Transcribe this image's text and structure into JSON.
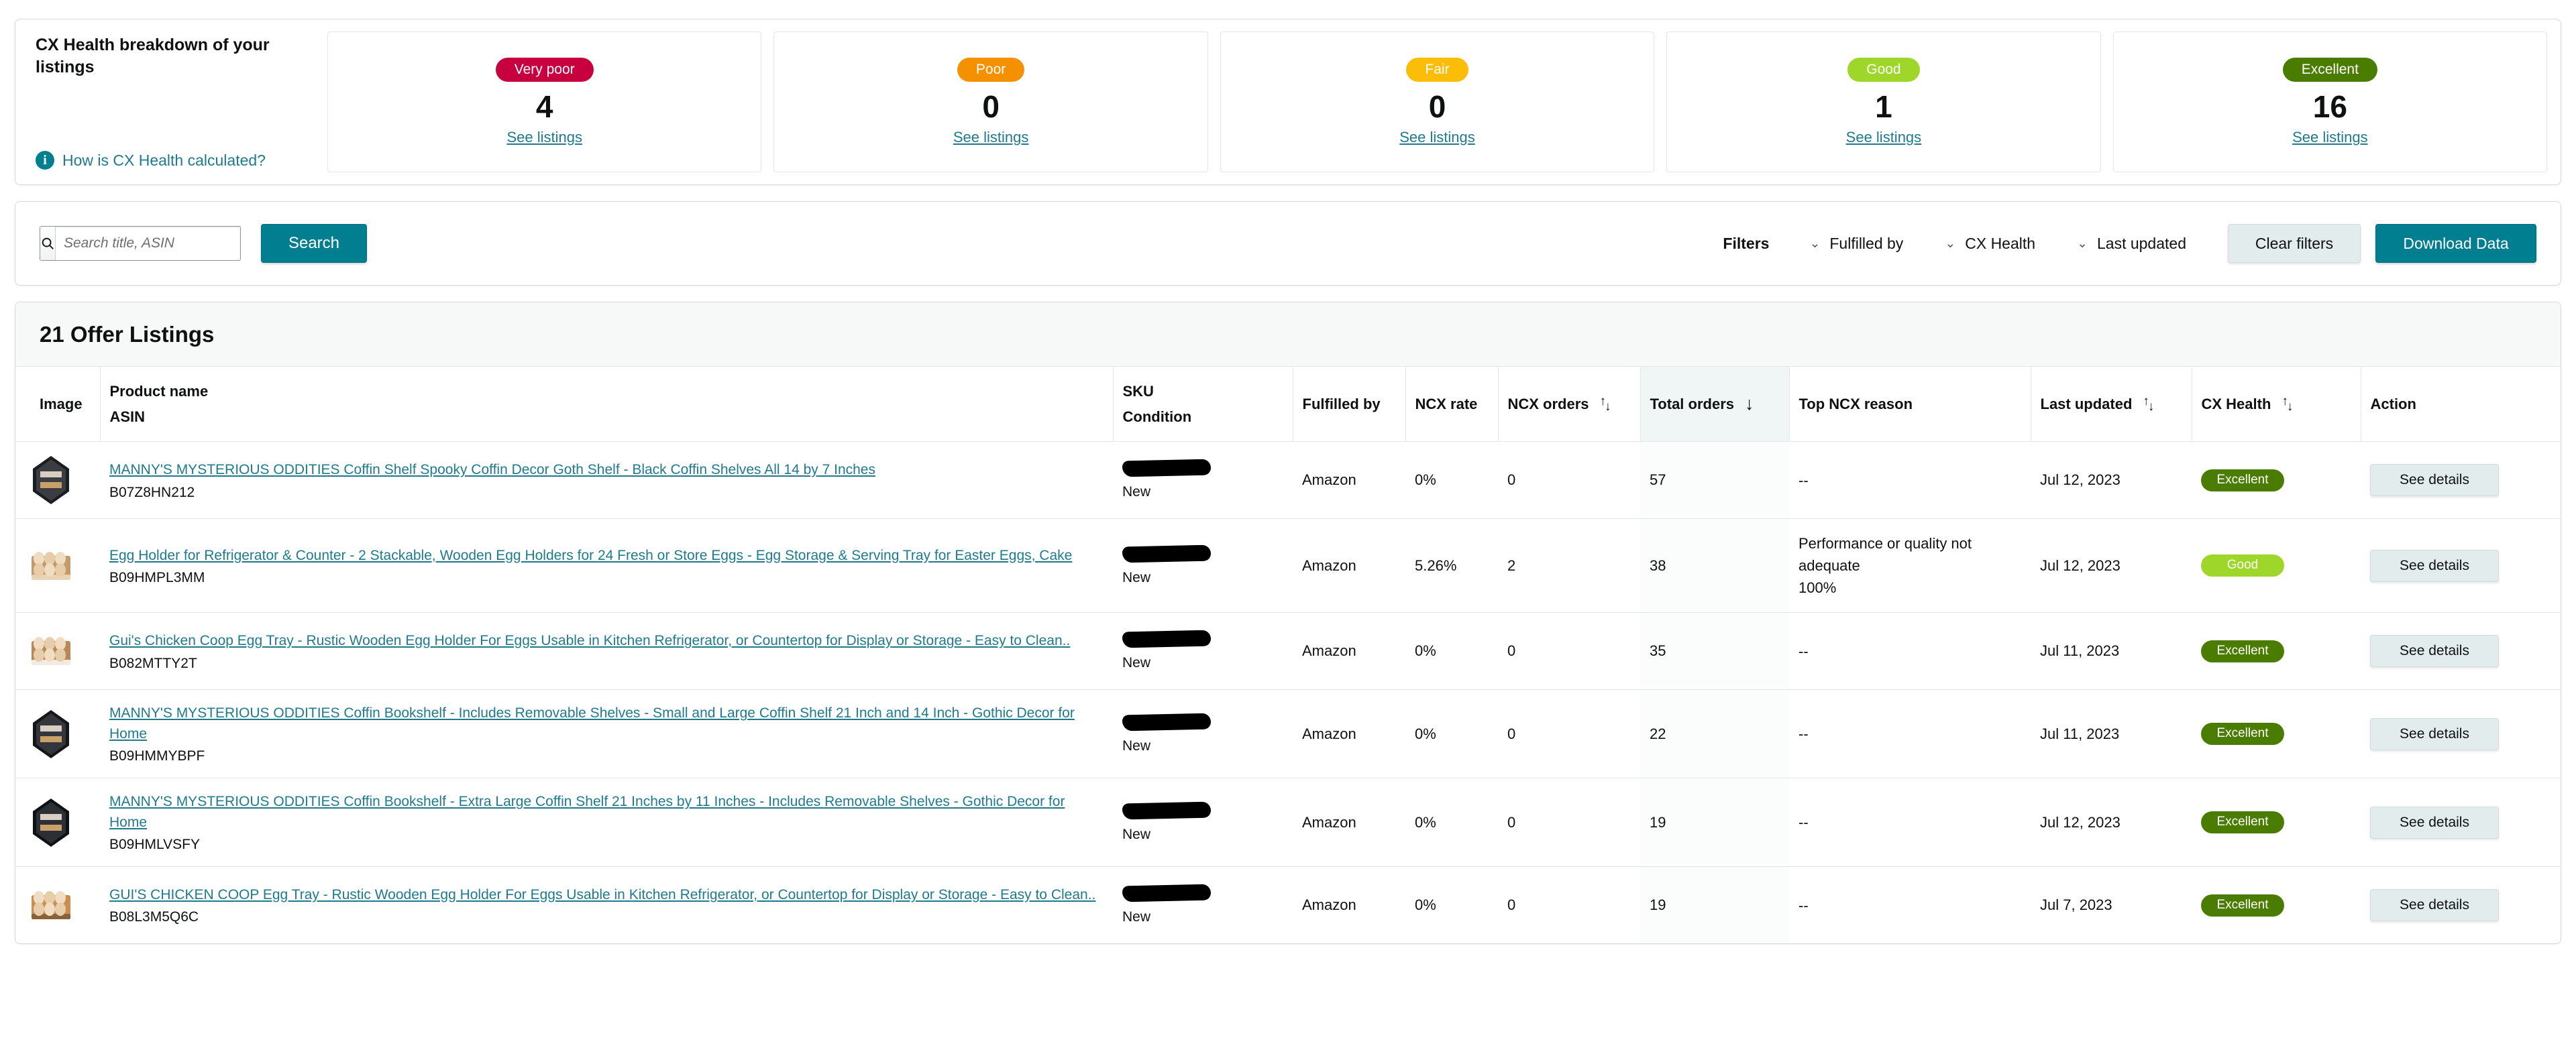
{
  "cx_breakdown": {
    "title": "CX Health breakdown of your listings",
    "help_link": "How is CX Health calculated?",
    "help_icon": "info-icon",
    "cards": [
      {
        "label": "Very poor",
        "count": "4",
        "link": "See listings",
        "color": "#c7003f"
      },
      {
        "label": "Poor",
        "count": "0",
        "link": "See listings",
        "color": "#f59100"
      },
      {
        "label": "Fair",
        "count": "0",
        "link": "See listings",
        "color": "#fbbd08"
      },
      {
        "label": "Good",
        "count": "1",
        "link": "See listings",
        "color": "#9ed62a"
      },
      {
        "label": "Excellent",
        "count": "16",
        "link": "See listings",
        "color": "#4a7c00"
      }
    ]
  },
  "filter_bar": {
    "search_placeholder": "Search title, ASIN",
    "search_value": "",
    "search_icon": "search-icon",
    "search_button": "Search",
    "filters_label": "Filters",
    "dropdowns": [
      {
        "label": "Fulfilled by"
      },
      {
        "label": "CX Health"
      },
      {
        "label": "Last updated"
      }
    ],
    "clear_filters": "Clear filters",
    "download_data": "Download Data"
  },
  "listings": {
    "title": "21 Offer Listings",
    "columns": {
      "image": "Image",
      "product_name": "Product name",
      "asin": "ASIN",
      "sku": "SKU",
      "condition": "Condition",
      "fulfilled_by": "Fulfilled by",
      "ncx_rate": "NCX rate",
      "ncx_orders": "NCX orders",
      "total_orders": "Total orders",
      "top_ncx_reason": "Top NCX reason",
      "last_updated": "Last updated",
      "cx_health": "CX Health",
      "action": "Action"
    },
    "sort": {
      "column": "Total orders",
      "direction": "desc",
      "icon": "arrow-down-icon"
    },
    "action_label": "See details",
    "rows": [
      {
        "product_name": "MANNY'S MYSTERIOUS ODDITIES Coffin Shelf Spooky Coffin Decor Goth Shelf - Black Coffin Shelves All 14 by 7 Inches",
        "asin": "B07Z8HN212",
        "sku": "",
        "condition": "New",
        "fulfilled_by": "Amazon",
        "ncx_rate": "0%",
        "ncx_orders": "0",
        "total_orders": "57",
        "top_ncx_reason": "--",
        "last_updated": "Jul 12, 2023",
        "cx_health": "Excellent",
        "cx_health_color": "#4a7c00",
        "thumb_colors": [
          "#3a3d42",
          "#1c1d20"
        ]
      },
      {
        "product_name": "Egg Holder for Refrigerator & Counter - 2 Stackable, Wooden Egg Holders for 24 Fresh or Store Eggs - Egg Storage & Serving Tray for Easter Eggs, Cake",
        "asin": "B09HMPL3MM",
        "sku": "",
        "condition": "New",
        "fulfilled_by": "Amazon",
        "ncx_rate": "5.26%",
        "ncx_orders": "2",
        "total_orders": "38",
        "top_ncx_reason": "Performance or quality not adequate\n100%",
        "last_updated": "Jul 12, 2023",
        "cx_health": "Good",
        "cx_health_color": "#9ed62a",
        "thumb_colors": [
          "#c49a68",
          "#e8d3b4"
        ]
      },
      {
        "product_name": "Gui's Chicken Coop Egg Tray - Rustic Wooden Egg Holder For Eggs Usable in Kitchen Refrigerator, or Countertop for Display or Storage - Easy to Clean..",
        "asin": "B082MTTY2T",
        "sku": "",
        "condition": "New",
        "fulfilled_by": "Amazon",
        "ncx_rate": "0%",
        "ncx_orders": "0",
        "total_orders": "35",
        "top_ncx_reason": "--",
        "last_updated": "Jul 11, 2023",
        "cx_health": "Excellent",
        "cx_health_color": "#4a7c00",
        "thumb_colors": [
          "#b78a58",
          "#f0ece3"
        ]
      },
      {
        "product_name": "MANNY'S MYSTERIOUS ODDITIES Coffin Bookshelf - Includes Removable Shelves - Small and Large Coffin Shelf 21 Inch and 14 Inch - Gothic Decor for Home",
        "asin": "B09HMMYBPF",
        "sku": "",
        "condition": "New",
        "fulfilled_by": "Amazon",
        "ncx_rate": "0%",
        "ncx_orders": "0",
        "total_orders": "22",
        "top_ncx_reason": "--",
        "last_updated": "Jul 11, 2023",
        "cx_health": "Excellent",
        "cx_health_color": "#4a7c00",
        "thumb_colors": [
          "#33363b",
          "#15161a"
        ]
      },
      {
        "product_name": "MANNY'S MYSTERIOUS ODDITIES Coffin Bookshelf - Extra Large Coffin Shelf 21 Inches by 11 Inches - Includes Removable Shelves - Gothic Decor for Home",
        "asin": "B09HMLVSFY",
        "sku": "",
        "condition": "New",
        "fulfilled_by": "Amazon",
        "ncx_rate": "0%",
        "ncx_orders": "0",
        "total_orders": "19",
        "top_ncx_reason": "--",
        "last_updated": "Jul 12, 2023",
        "cx_health": "Excellent",
        "cx_health_color": "#4a7c00",
        "thumb_colors": [
          "#2c2f34",
          "#101114"
        ]
      },
      {
        "product_name": "GUI'S CHICKEN COOP Egg Tray - Rustic Wooden Egg Holder For Eggs Usable in Kitchen Refrigerator, or Countertop for Display or Storage - Easy to Clean..",
        "asin": "B08L3M5Q6C",
        "sku": "",
        "condition": "New",
        "fulfilled_by": "Amazon",
        "ncx_rate": "0%",
        "ncx_orders": "0",
        "total_orders": "19",
        "top_ncx_reason": "--",
        "last_updated": "Jul 7, 2023",
        "cx_health": "Excellent",
        "cx_health_color": "#4a7c00",
        "thumb_colors": [
          "#c98f52",
          "#8a6239"
        ]
      }
    ]
  }
}
